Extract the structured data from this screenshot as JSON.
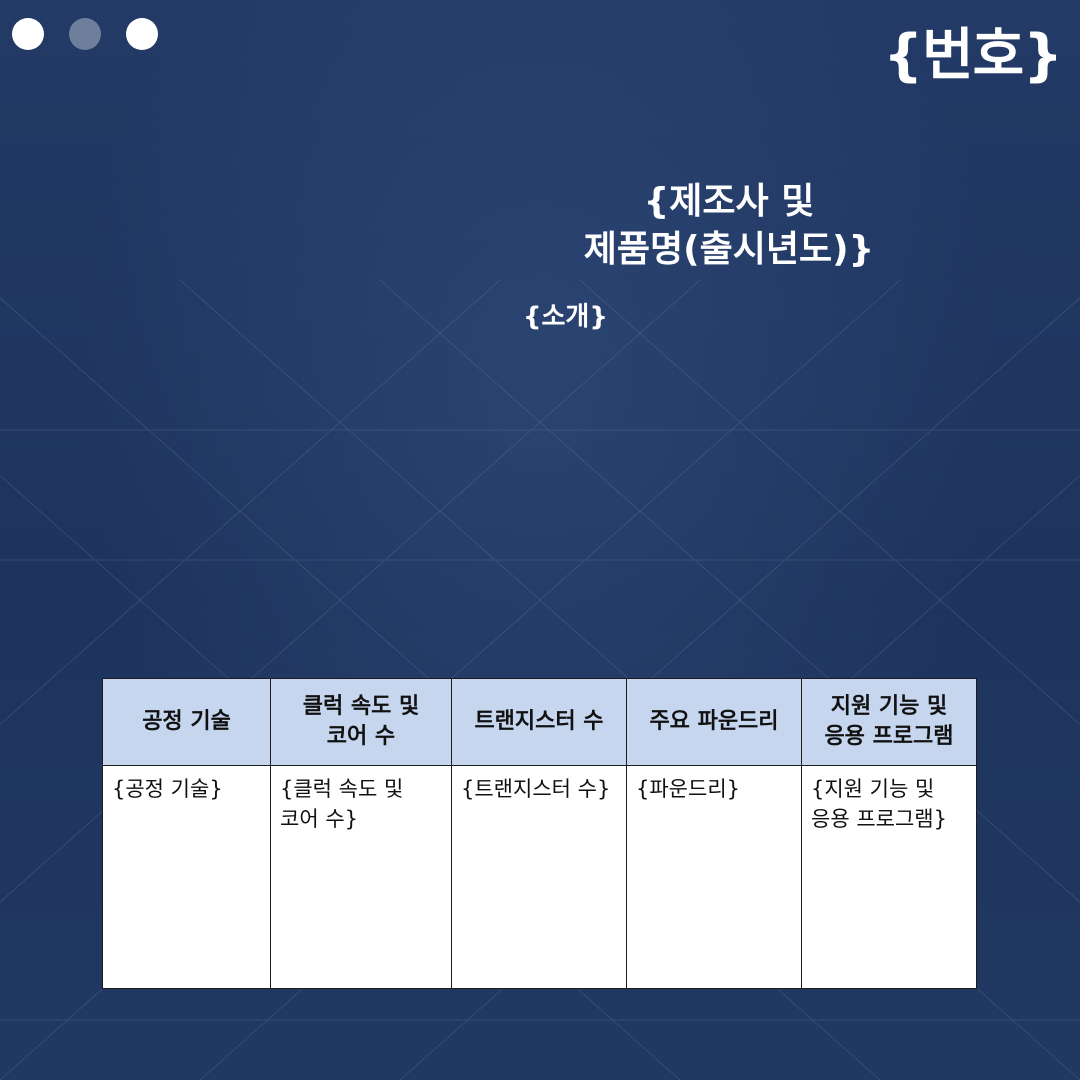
{
  "header": {
    "window_dots": [
      "white",
      "gray",
      "white"
    ],
    "number_label": "{번호}"
  },
  "title": {
    "text": "{제조사 및\n제품명(출시년도)}"
  },
  "intro": {
    "text": "{소개}"
  },
  "spec_table": {
    "headers": [
      "공정 기술",
      "클럭 속도 및\n코어 수",
      "트랜지스터 수",
      "주요 파운드리",
      "지원 기능 및\n응용 프로그램"
    ],
    "values": [
      "{공정 기술}",
      "{클럭 속도 및\n코어 수}",
      "{트랜지스터 수}",
      "{파운드리}",
      "{지원 기능 및\n응용 프로그램}"
    ]
  },
  "colors": {
    "background": "#1f355f",
    "header_cell": "#c5d6ee",
    "text_light": "#ffffff"
  }
}
